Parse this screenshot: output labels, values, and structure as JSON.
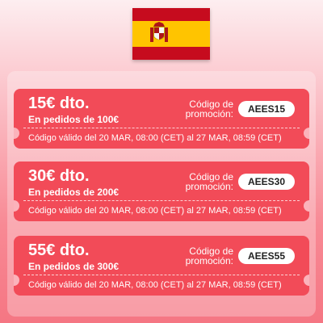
{
  "flag": {
    "country": "Spain",
    "icon": "spain-flag-icon",
    "colors": {
      "red": "#c60b1e",
      "yellow": "#ffc400"
    }
  },
  "colors": {
    "coupon_bg": "#f24b58",
    "pill_bg": "#ffffff"
  },
  "coupons": [
    {
      "amount": "15€ dto.",
      "minimum": "En pedidos de 100€",
      "code_label_line1": "Código de",
      "code_label_line2": "promoción:",
      "code": "AEES15",
      "validity": "Código válido del 20 MAR, 08:00 (CET) al 27 MAR, 08:59 (CET)"
    },
    {
      "amount": "30€ dto.",
      "minimum": "En pedidos de 200€",
      "code_label_line1": "Código de",
      "code_label_line2": "promoción:",
      "code": "AEES30",
      "validity": "Código válido del 20 MAR, 08:00 (CET) al 27 MAR, 08:59 (CET)"
    },
    {
      "amount": "55€ dto.",
      "minimum": "En pedidos de 300€",
      "code_label_line1": "Código de",
      "code_label_line2": "promoción:",
      "code": "AEES55",
      "validity": "Código válido del 20 MAR, 08:00 (CET) al 27 MAR, 08:59 (CET)"
    }
  ]
}
